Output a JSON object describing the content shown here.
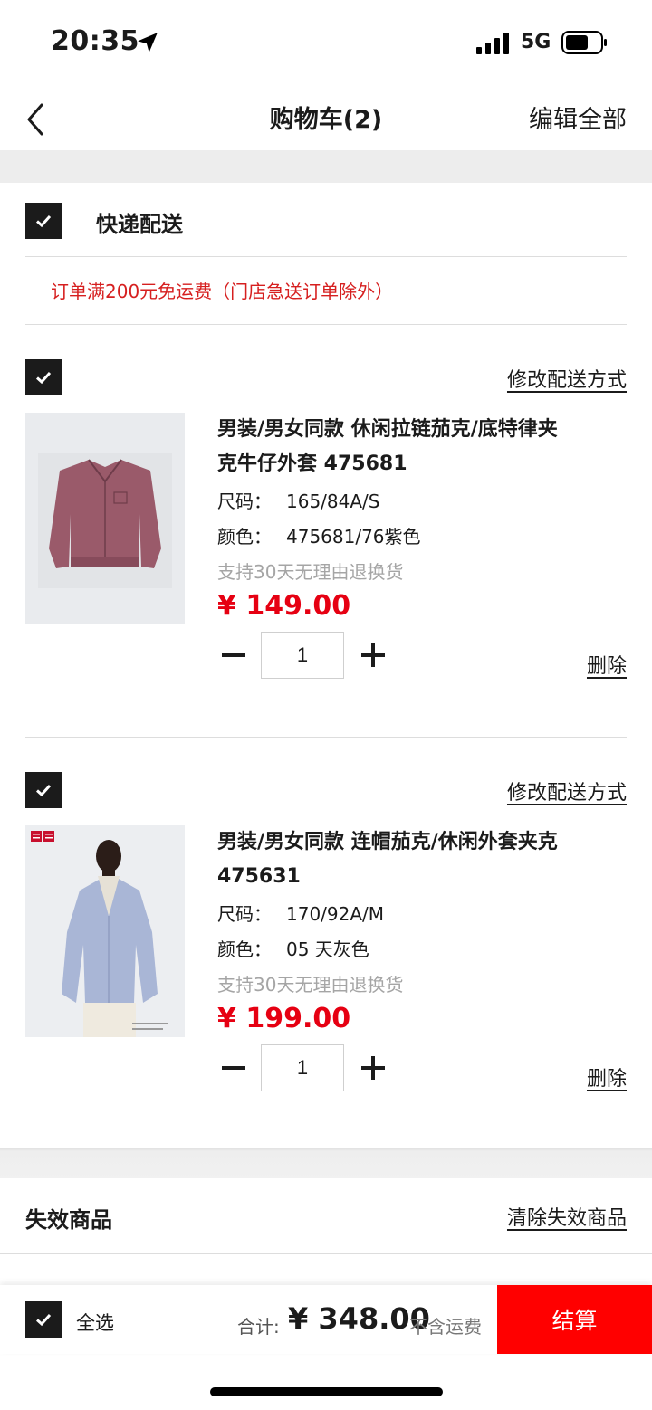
{
  "status_bar": {
    "time": "20:35",
    "network": "5G"
  },
  "header": {
    "title": "购物车(2)",
    "edit_all": "编辑全部"
  },
  "shipping": {
    "method": "快递配送",
    "notice": "订单满200元免运费（门店急送订单除外）"
  },
  "items": [
    {
      "change_delivery": "修改配送方式",
      "name_line1": "男装/男女同款 休闲拉链茄克/底特律夹",
      "name_line2": "克牛仔外套 475681",
      "size_label": "尺码：",
      "size": "165/84A/S",
      "color_label": "颜色：",
      "color": "475681/76紫色",
      "return_note": "支持30天无理由退换货",
      "price": "¥ 149.00",
      "quantity": "1",
      "delete": "删除",
      "image_color": "#9a5a6a"
    },
    {
      "change_delivery": "修改配送方式",
      "name_line1": "男装/男女同款 连帽茄克/休闲外套夹克",
      "name_line2": "475631",
      "size_label": "尺码：",
      "size": "170/92A/M",
      "color_label": "颜色：",
      "color": "05 天灰色",
      "return_note": "支持30天无理由退换货",
      "price": "¥ 199.00",
      "quantity": "1",
      "delete": "删除",
      "image_color": "#a9b6d6"
    }
  ],
  "invalid": {
    "title": "失效商品",
    "clear": "清除失效商品"
  },
  "footer": {
    "select_all": "全选",
    "total_label": "合计:",
    "total_amount": "¥ 348.00",
    "shipping_note": "不含运费",
    "checkout": "结算"
  },
  "colors": {
    "price_red": "#e60012",
    "checkout_red": "#ff0000",
    "notice_red": "#d61f1f"
  }
}
